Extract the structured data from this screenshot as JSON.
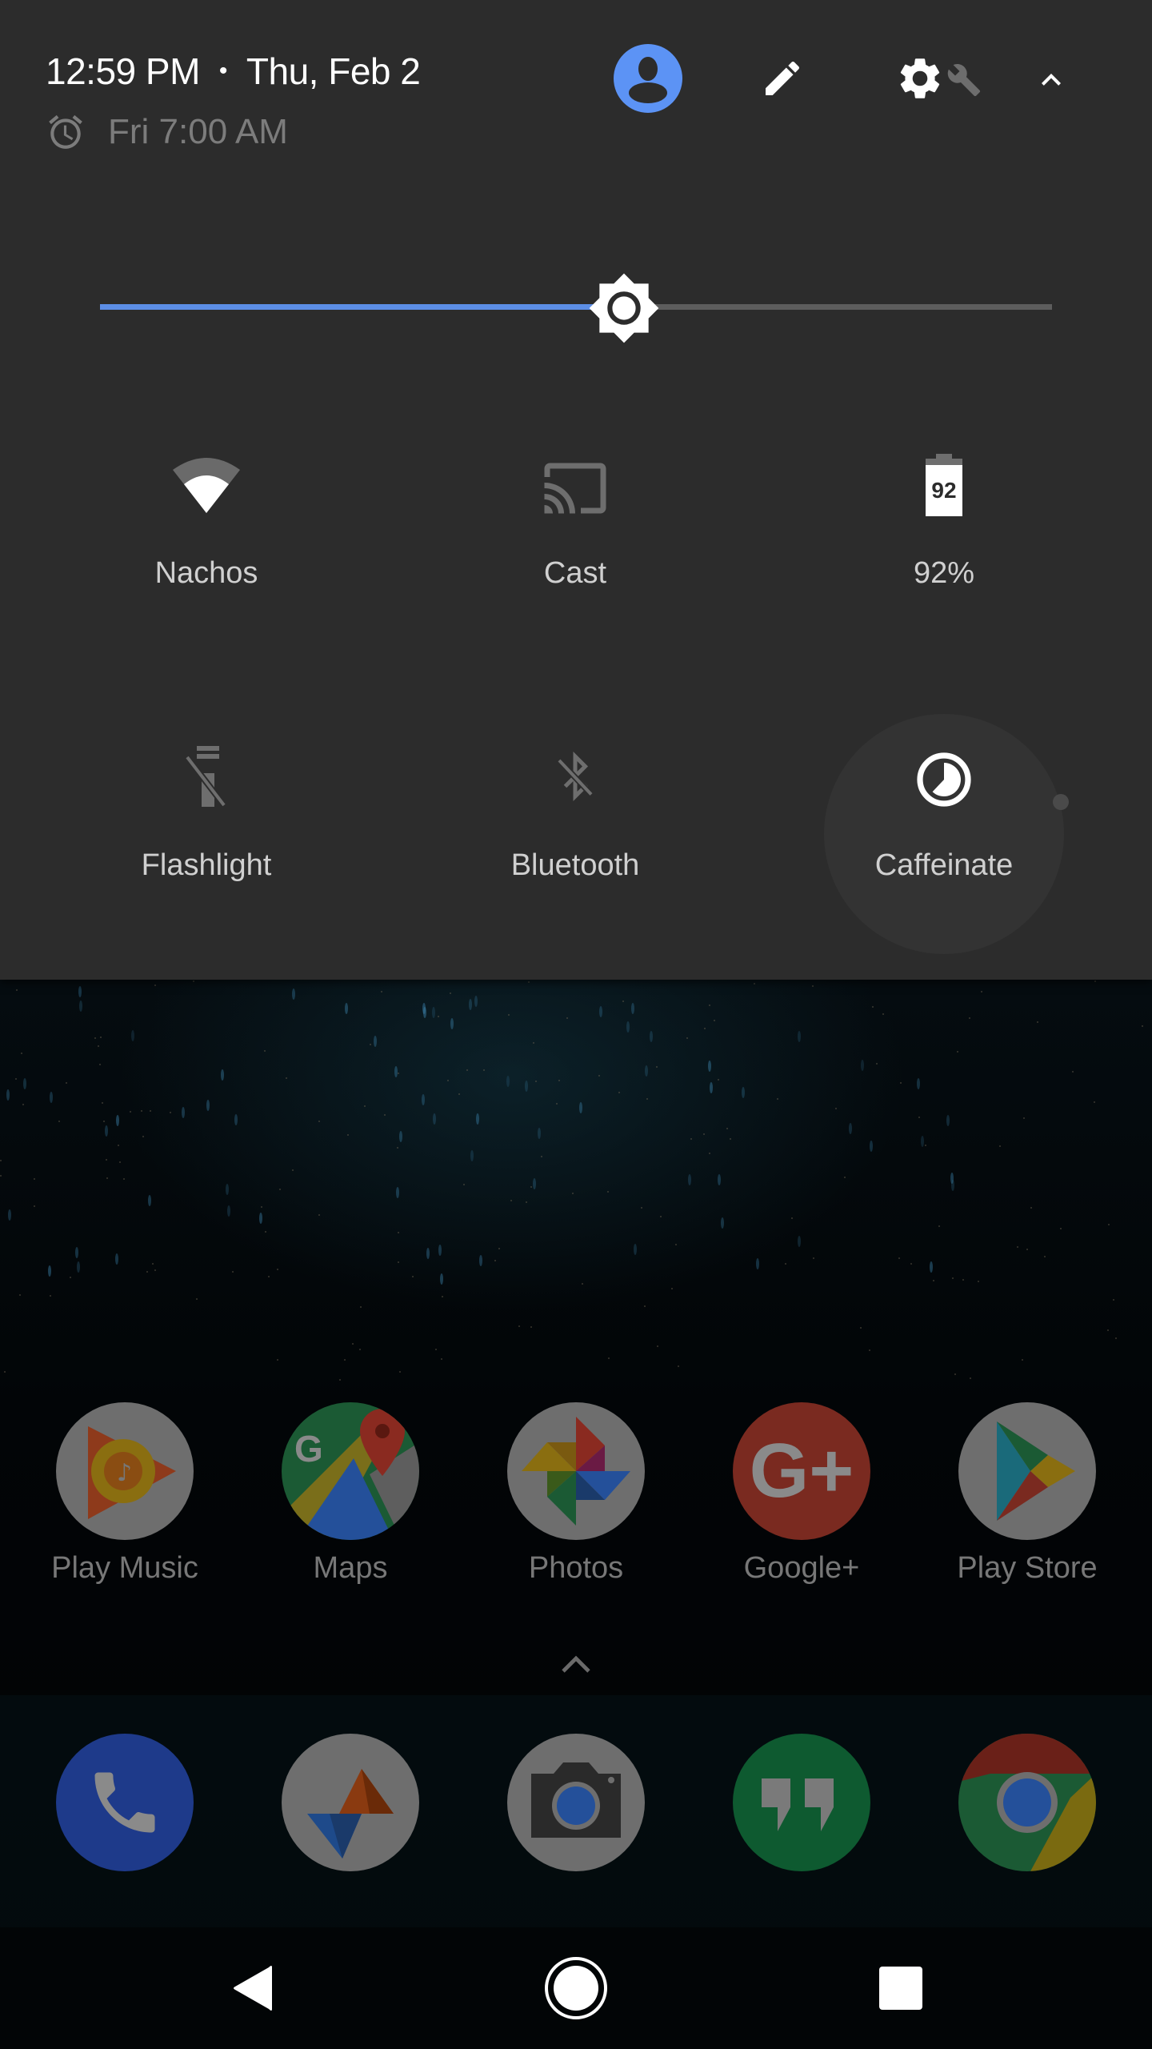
{
  "status": {
    "time": "12:59 PM",
    "separator": "•",
    "date": "Thu, Feb 2",
    "alarm": "Fri 7:00 AM"
  },
  "header_icons": {
    "user": "account-circle-icon",
    "edit": "pencil-icon",
    "settings": "gear-icon",
    "tuner": "wrench-icon",
    "collapse": "chevron-up-icon"
  },
  "brightness": {
    "level": 0.55,
    "accent": "#5c8ee6"
  },
  "tiles": [
    {
      "label": "Nachos",
      "icon": "wifi-icon",
      "state": "on"
    },
    {
      "label": "Cast",
      "icon": "cast-icon",
      "state": "off"
    },
    {
      "label": "92%",
      "icon": "battery-icon",
      "battery_text": "92",
      "state": "info"
    },
    {
      "label": "Flashlight",
      "icon": "flashlight-off-icon",
      "state": "off"
    },
    {
      "label": "Bluetooth",
      "icon": "bluetooth-off-icon",
      "state": "off"
    },
    {
      "label": "Caffeinate",
      "icon": "caffeinate-timer-icon",
      "state": "on"
    }
  ],
  "home_apps": [
    {
      "name": "Play Music",
      "icon": "play-music-icon"
    },
    {
      "name": "Maps",
      "icon": "maps-icon"
    },
    {
      "name": "Photos",
      "icon": "photos-icon"
    },
    {
      "name": "Google+",
      "icon": "google-plus-icon"
    },
    {
      "name": "Play Store",
      "icon": "play-store-icon"
    }
  ],
  "dock_apps": [
    {
      "name": "Phone",
      "icon": "phone-icon"
    },
    {
      "name": "Inbox-style app",
      "icon": "compass-app-icon"
    },
    {
      "name": "Camera",
      "icon": "camera-icon"
    },
    {
      "name": "Hangouts",
      "icon": "hangouts-icon"
    },
    {
      "name": "Chrome",
      "icon": "chrome-icon"
    }
  ],
  "nav": {
    "back": "back-icon",
    "home": "home-icon",
    "recents": "recents-icon"
  }
}
